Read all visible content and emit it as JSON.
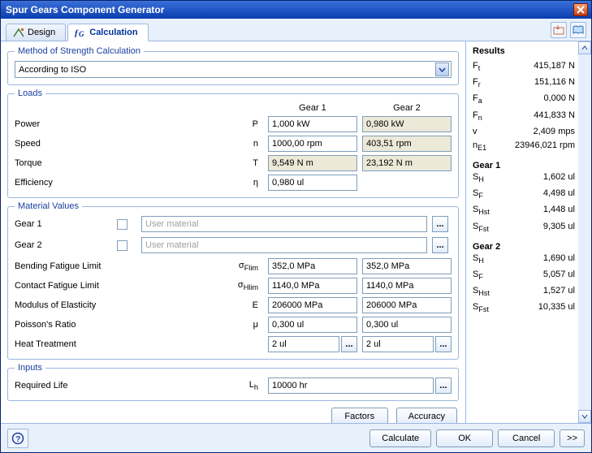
{
  "window": {
    "title": "Spur Gears Component Generator"
  },
  "tabs": {
    "design": "Design",
    "calculation": "Calculation"
  },
  "method": {
    "legend": "Method of Strength Calculation",
    "value": "According to ISO"
  },
  "loads": {
    "legend": "Loads",
    "gear1": "Gear 1",
    "gear2": "Gear 2",
    "power_label": "Power",
    "power_sym": "P",
    "power_g1": "1,000 kW",
    "power_g2": "0,980 kW",
    "speed_label": "Speed",
    "speed_sym": "n",
    "speed_g1": "1000,00 rpm",
    "speed_g2": "403,51 rpm",
    "torque_label": "Torque",
    "torque_sym": "T",
    "torque_g1": "9,549 N m",
    "torque_g2": "23,192 N m",
    "eff_label": "Efficiency",
    "eff_sym": "η",
    "eff_val": "0,980 ul"
  },
  "material": {
    "legend": "Material Values",
    "gear1": "Gear 1",
    "gear2": "Gear 2",
    "user_placeholder": "User material",
    "bending_label": "Bending Fatigue Limit",
    "bending_sym": "σFlim",
    "bending_g1": "352,0 MPa",
    "bending_g2": "352,0 MPa",
    "contact_label": "Contact Fatigue Limit",
    "contact_sym": "σHlim",
    "contact_g1": "1140,0 MPa",
    "contact_g2": "1140,0 MPa",
    "modulus_label": "Modulus of Elasticity",
    "modulus_sym": "E",
    "modulus_g1": "206000 MPa",
    "modulus_g2": "206000 MPa",
    "poisson_label": "Poisson's Ratio",
    "poisson_sym": "μ",
    "poisson_g1": "0,300 ul",
    "poisson_g2": "0,300 ul",
    "heat_label": "Heat Treatment",
    "heat_g1": "2 ul",
    "heat_g2": "2 ul"
  },
  "inputs": {
    "legend": "Inputs",
    "req_life_label": "Required Life",
    "req_life_sym": "Lh",
    "req_life_val": "10000 hr"
  },
  "buttons": {
    "factors": "Factors",
    "accuracy": "Accuracy",
    "calculate": "Calculate",
    "ok": "OK",
    "cancel": "Cancel",
    "more": ">>",
    "ellipsis": "..."
  },
  "results": {
    "title": "Results",
    "Ft": "415,187 N",
    "Fr": "151,116 N",
    "Fa": "0,000 N",
    "Fn": "441,833 N",
    "v": "2,409 mps",
    "nE1": "23946,021 rpm",
    "gear1_title": "Gear 1",
    "g1_SH": "1,602 ul",
    "g1_SF": "4,498 ul",
    "g1_SHst": "1,448 ul",
    "g1_SFst": "9,305 ul",
    "gear2_title": "Gear 2",
    "g2_SH": "1,690 ul",
    "g2_SF": "5,057 ul",
    "g2_SHst": "1,527 ul",
    "g2_SFst": "10,335 ul"
  }
}
